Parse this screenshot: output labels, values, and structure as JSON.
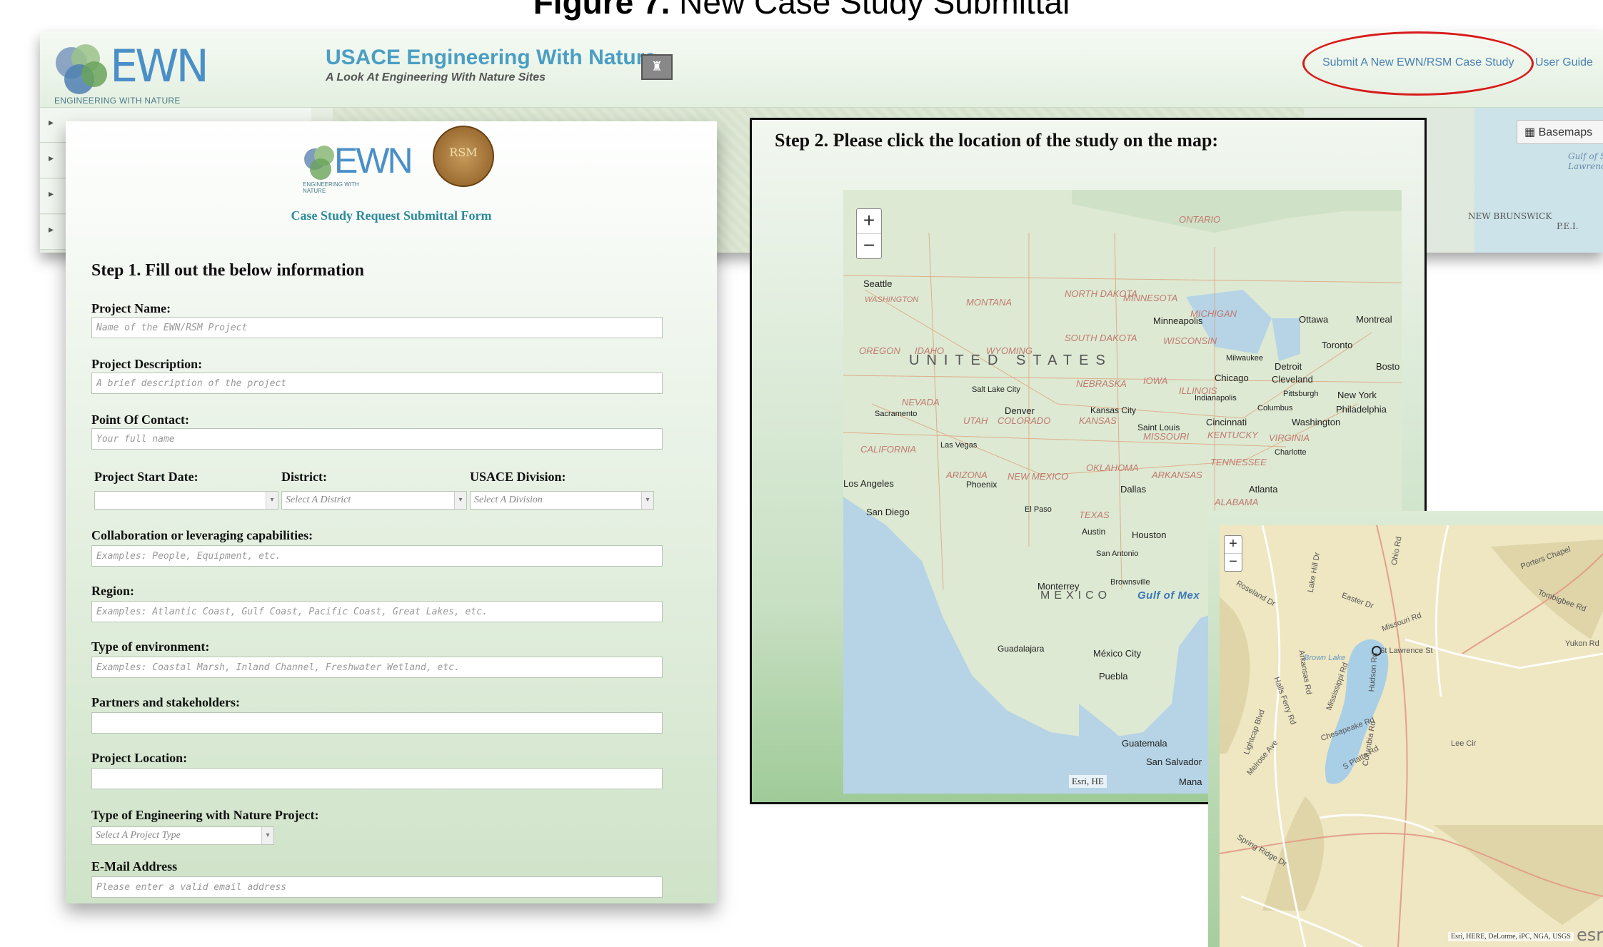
{
  "figure_title_bold": "Figure 7.",
  "figure_title_rest": " New Case Study Submittal",
  "app": {
    "logo_text": "EWN",
    "logo_sub": "ENGINEERING WITH NATURE",
    "title": "USACE Engineering With Nature",
    "subtitle": "A Look At Engineering With Nature Sites",
    "nav_submit": "Submit A New EWN/RSM Case Study",
    "nav_guide": "User Guide",
    "basemaps_label": "Basemaps",
    "map_labels": [
      "NEW BRUNSWICK",
      "P.E.I.",
      "Gulf of St Lawrence"
    ],
    "sidebar_count": 4
  },
  "form": {
    "logo_text": "EWN",
    "logo_sub": "ENGINEERING WITH NATURE",
    "rsm_text": "RSM",
    "heading": "Case Study Request Submittal Form",
    "step1": "Step 1. Fill out the below information",
    "fields": {
      "project_name": {
        "label": "Project Name:",
        "placeholder": "Name of the EWN/RSM Project"
      },
      "project_description": {
        "label": "Project Description:",
        "placeholder": "A brief description of the project"
      },
      "point_of_contact": {
        "label": "Point Of Contact:",
        "placeholder": "Your full name"
      },
      "start_date": {
        "label": "Project Start Date:",
        "value": ""
      },
      "district": {
        "label": "District:",
        "value": "Select A District"
      },
      "division": {
        "label": "USACE Division:",
        "value": "Select A Division"
      },
      "collaboration": {
        "label": "Collaboration or leveraging capabilities:",
        "placeholder": "Examples: People, Equipment, etc."
      },
      "region": {
        "label": "Region:",
        "placeholder": "Examples: Atlantic Coast, Gulf Coast, Pacific Coast, Great Lakes, etc."
      },
      "environment": {
        "label": "Type of environment:",
        "placeholder": "Examples: Coastal Marsh, Inland Channel, Freshwater Wetland, etc."
      },
      "partners": {
        "label": "Partners and stakeholders:",
        "placeholder": ""
      },
      "location": {
        "label": "Project Location:",
        "placeholder": ""
      },
      "ewn_type": {
        "label": "Type of Engineering with Nature Project:",
        "value": "Select A Project Type"
      },
      "email": {
        "label": "E-Mail Address",
        "placeholder": "Please enter a valid email address"
      }
    }
  },
  "step2": {
    "title": "Step 2. Please click the location of the study on the map:",
    "zoom_in": "+",
    "zoom_out": "−",
    "country_label": "UNITED STATES",
    "mexico_label": "MEXICO",
    "water_label": "Gulf of Mex",
    "ontario_label": "ONTARIO",
    "cities": [
      "Seattle",
      "Minneapolis",
      "Ottawa",
      "Montreal",
      "Toronto",
      "Milwaukee",
      "Detroit",
      "Bosto",
      "Chicago",
      "Cleveland",
      "Salt Lake City",
      "Indianapolis",
      "Pittsburgh",
      "New York",
      "Denver",
      "Kansas City",
      "Columbus",
      "Philadelphia",
      "Sacramento",
      "Saint Louis",
      "Cincinnati",
      "Washington",
      "Las Vegas",
      "Charlotte",
      "Los Angeles",
      "Phoenix",
      "Dallas",
      "Atlanta",
      "San Diego",
      "El Paso",
      "Austin",
      "Houston",
      "San Antonio",
      "Monterrey",
      "Brownsville",
      "Guadalajara",
      "México City",
      "Puebla",
      "Guatemala",
      "San Salvador",
      "Mana"
    ],
    "states": [
      "WASHINGTON",
      "MONTANA",
      "NORTH DAKOTA",
      "MINNESOTA",
      "MICHIGAN",
      "OREGON",
      "IDAHO",
      "WYOMING",
      "SOUTH DAKOTA",
      "WISCONSIN",
      "NEBRASKA",
      "IOWA",
      "ILLINOIS",
      "NEVADA",
      "UTAH",
      "COLORADO",
      "KANSAS",
      "MISSOURI",
      "KENTUCKY",
      "VIRGINIA",
      "CALIFORNIA",
      "ARIZONA",
      "NEW MEXICO",
      "OKLAHOMA",
      "ARKANSAS",
      "TENNESSEE",
      "TEXAS",
      "ALABAMA"
    ],
    "attribution": "Esri, HE"
  },
  "zoom_map": {
    "zoom_in": "+",
    "zoom_out": "−",
    "streets": [
      "Roseland Dr",
      "Easter Dr",
      "Ohio Rd",
      "Missouri Rd",
      "Porters Chapel",
      "St Lawrence St",
      "Halls Ferry Rd",
      "Arkansas Rd",
      "Mississippi Rd",
      "Chesapeake Rd",
      "Columbia Rd",
      "Lee Cir",
      "Melrose Ave",
      "Spring Ridge Dr",
      "Yukon Rd",
      "Hudson Rd",
      "Tombigbee Rd",
      "Lake Hill Dr",
      "Brown Lake",
      "Lightcap Blvd",
      "S Platte Rd"
    ],
    "attribution": "Esri, HERE, DeLorme, iPC, NGA, USGS",
    "esri": "esri"
  }
}
